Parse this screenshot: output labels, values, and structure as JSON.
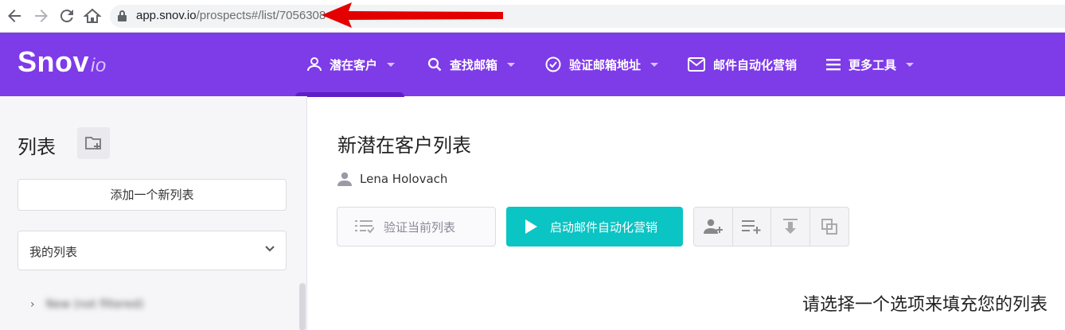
{
  "browser": {
    "url_host": "app.snov.io",
    "url_path": "/prospects#/list/7056308",
    "icons": [
      "back-arrow-icon",
      "forward-arrow-icon",
      "reload-icon",
      "home-icon",
      "lock-icon"
    ]
  },
  "header": {
    "logo_main": "Snov",
    "logo_suffix": "io",
    "menu": [
      {
        "label": "潜在客户",
        "icon": "user-icon",
        "has_dropdown": true,
        "active": true
      },
      {
        "label": "查找邮箱",
        "icon": "search-icon",
        "has_dropdown": true
      },
      {
        "label": "验证邮箱地址",
        "icon": "check-circle-icon",
        "has_dropdown": true
      },
      {
        "label": "邮件自动化营销",
        "icon": "mail-icon",
        "has_dropdown": false
      },
      {
        "label": "更多工具",
        "icon": "menu-icon",
        "has_dropdown": true
      }
    ]
  },
  "sidebar": {
    "title": "列表",
    "add_list_label": "添加一个新列表",
    "my_lists_label": "我的列表",
    "first_list_label": "New (not filtered)"
  },
  "main": {
    "title": "新潜在客户列表",
    "owner": "Lena Holovach",
    "verify_label": "验证当前列表",
    "campaign_label": "启动邮件自动化营销",
    "prompt": "请选择一个选项来填充您的列表"
  },
  "colors": {
    "header_bg": "#7e3be8",
    "active_tab": "#5e1fc7",
    "campaign_button": "#0bc4c4",
    "annotation_arrow": "#e50000"
  }
}
